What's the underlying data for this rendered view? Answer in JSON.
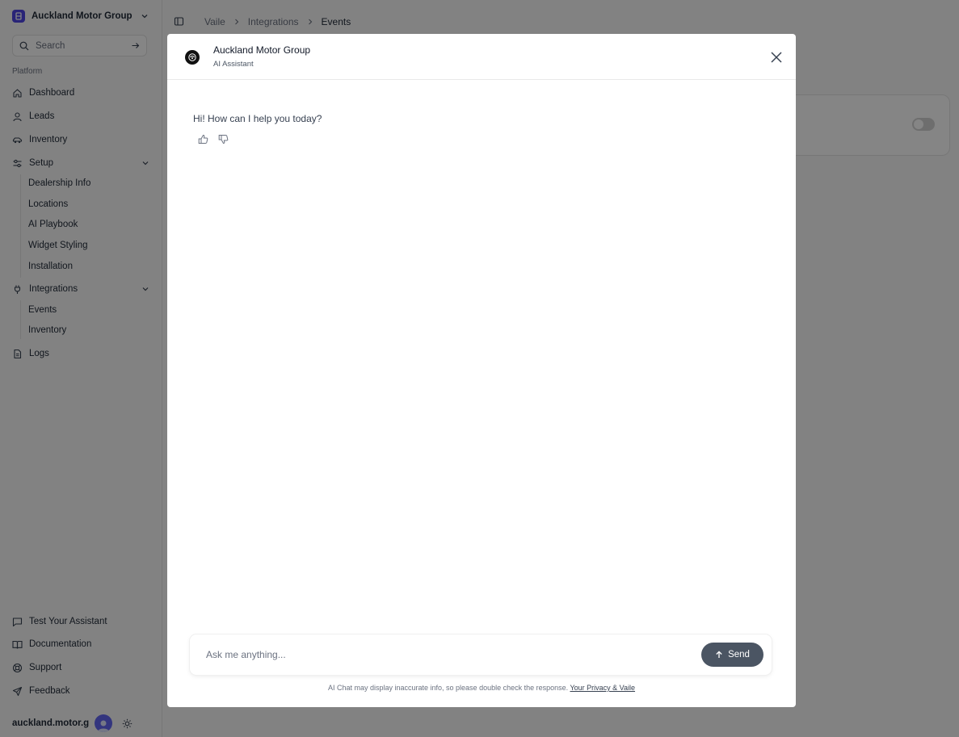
{
  "sidebar": {
    "org_name": "Auckland Motor Group",
    "search_placeholder": "Search",
    "section_label": "Platform",
    "nav": {
      "dashboard": "Dashboard",
      "leads": "Leads",
      "inventory": "Inventory",
      "setup": "Setup",
      "setup_items": [
        "Dealership Info",
        "Locations",
        "AI Playbook",
        "Widget Styling",
        "Installation"
      ],
      "integrations": "Integrations",
      "integrations_items": [
        "Events",
        "Inventory"
      ],
      "logs": "Logs"
    },
    "footer": {
      "test_assistant": "Test Your Assistant",
      "documentation": "Documentation",
      "support": "Support",
      "feedback": "Feedback",
      "user_name": "auckland.motor.gr..."
    }
  },
  "breadcrumb": [
    "Vaile",
    "Integrations",
    "Events"
  ],
  "modal": {
    "title": "Auckland Motor Group",
    "subtitle": "AI Assistant",
    "greeting": "Hi! How can I help you today?",
    "input_placeholder": "Ask me anything...",
    "send_label": "Send",
    "disclaimer": "AI Chat may display inaccurate info, so please double check the response.",
    "privacy_link": "Your Privacy & Vaile"
  },
  "colors": {
    "brand": "#4f46e5",
    "send_button": "#4b5563",
    "overlay": "rgba(0,0,0,0.48)"
  }
}
